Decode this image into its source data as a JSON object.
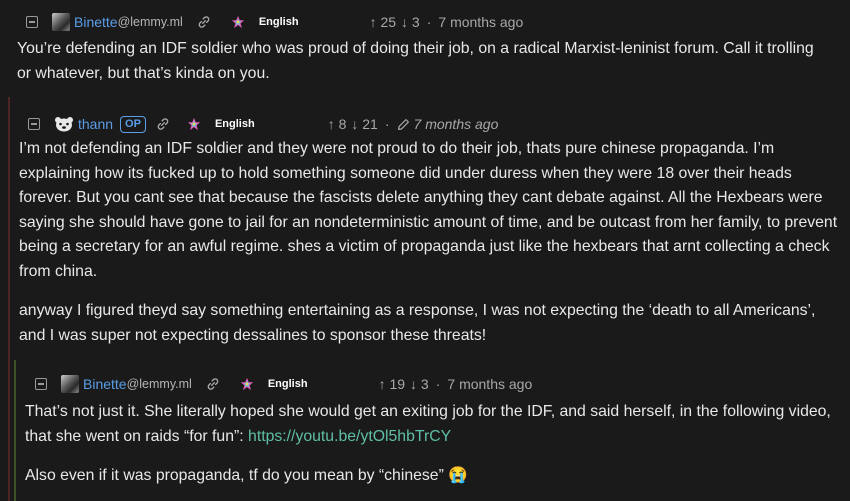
{
  "comments": [
    {
      "username": "Binette",
      "instance": "@lemmy.ml",
      "language": "English",
      "upvotes": "25",
      "downvotes": "3",
      "time": "7 months ago",
      "paragraphs": [
        "You’re defending an IDF soldier who was proud of doing their job, on a radical Marxist-leninist forum. Call it trolling or whatever, but that’s kinda on you."
      ]
    },
    {
      "username": "thann",
      "op_badge": "OP",
      "language": "English",
      "upvotes": "8",
      "downvotes": "21",
      "time": "7 months ago",
      "edited": true,
      "paragraphs": [
        "I’m not defending an IDF soldier and they were not proud to do their job, thats pure chinese propaganda. I’m explaining how its fucked up to hold something someone did under duress when they were 18 over their heads forever. But you cant see that because the fascists delete anything they cant debate against. All the Hexbears were saying she should have gone to jail for an nondeterministic amount of time, and be outcast from her family, to prevent being a secretary for an awful regime. shes a victim of propaganda just like the hexbears that arnt collecting a check from china.",
        "anyway I figured theyd say something entertaining as a response, I was not expecting the ‘death to all Americans’, and I was super not expecting dessalines to sponsor these threats!"
      ]
    },
    {
      "username": "Binette",
      "instance": "@lemmy.ml",
      "language": "English",
      "upvotes": "19",
      "downvotes": "3",
      "time": "7 months ago",
      "p1_before_link": "That’s not just it. She literally hoped she would get an exiting job for the IDF, and said herself, in the following video, that she went on raids “for fun”: ",
      "p1_link": "https://youtu.be/ytOl5hbTrCY",
      "p2_text": "Also even if it was propaganda, tf do you mean by “chinese” ",
      "p2_emoji": "😭"
    }
  ],
  "symbols": {
    "up_arrow": "↑",
    "down_arrow": "↓",
    "separator": "·"
  }
}
